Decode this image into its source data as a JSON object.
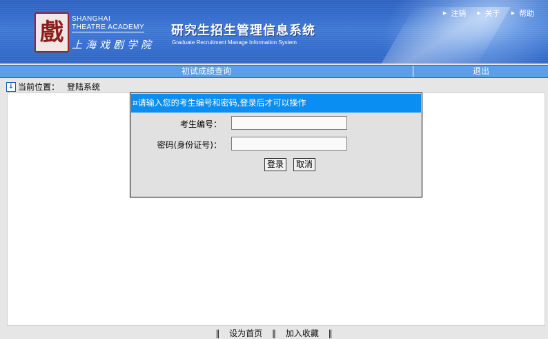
{
  "header": {
    "school_en_line1": "SHANGHAI",
    "school_en_line2": "THEATRE ACADEMY",
    "school_cn": "上海戏剧学院",
    "logo_glyph": "戲",
    "title_cn": "研究生招生管理信息系统",
    "title_en": "Graduate Recruitment Manage Information System",
    "links": [
      "注销",
      "关于",
      "帮助"
    ]
  },
  "nav": {
    "left": "初试成绩查询",
    "right": "退出"
  },
  "breadcrumb": {
    "prefix": "当前位置：",
    "current": "登陆系统"
  },
  "login": {
    "header": "¤请输入您的考生编号和密码,登录后才可以操作",
    "id_label": "考生编号：",
    "id_value": "",
    "pwd_label": "密码(身份证号)：",
    "pwd_value": "",
    "login_button": "登录",
    "cancel_button": "取消"
  },
  "footer": {
    "sep": "‖",
    "set_home": "设为首页",
    "add_fav": "加入收藏"
  }
}
